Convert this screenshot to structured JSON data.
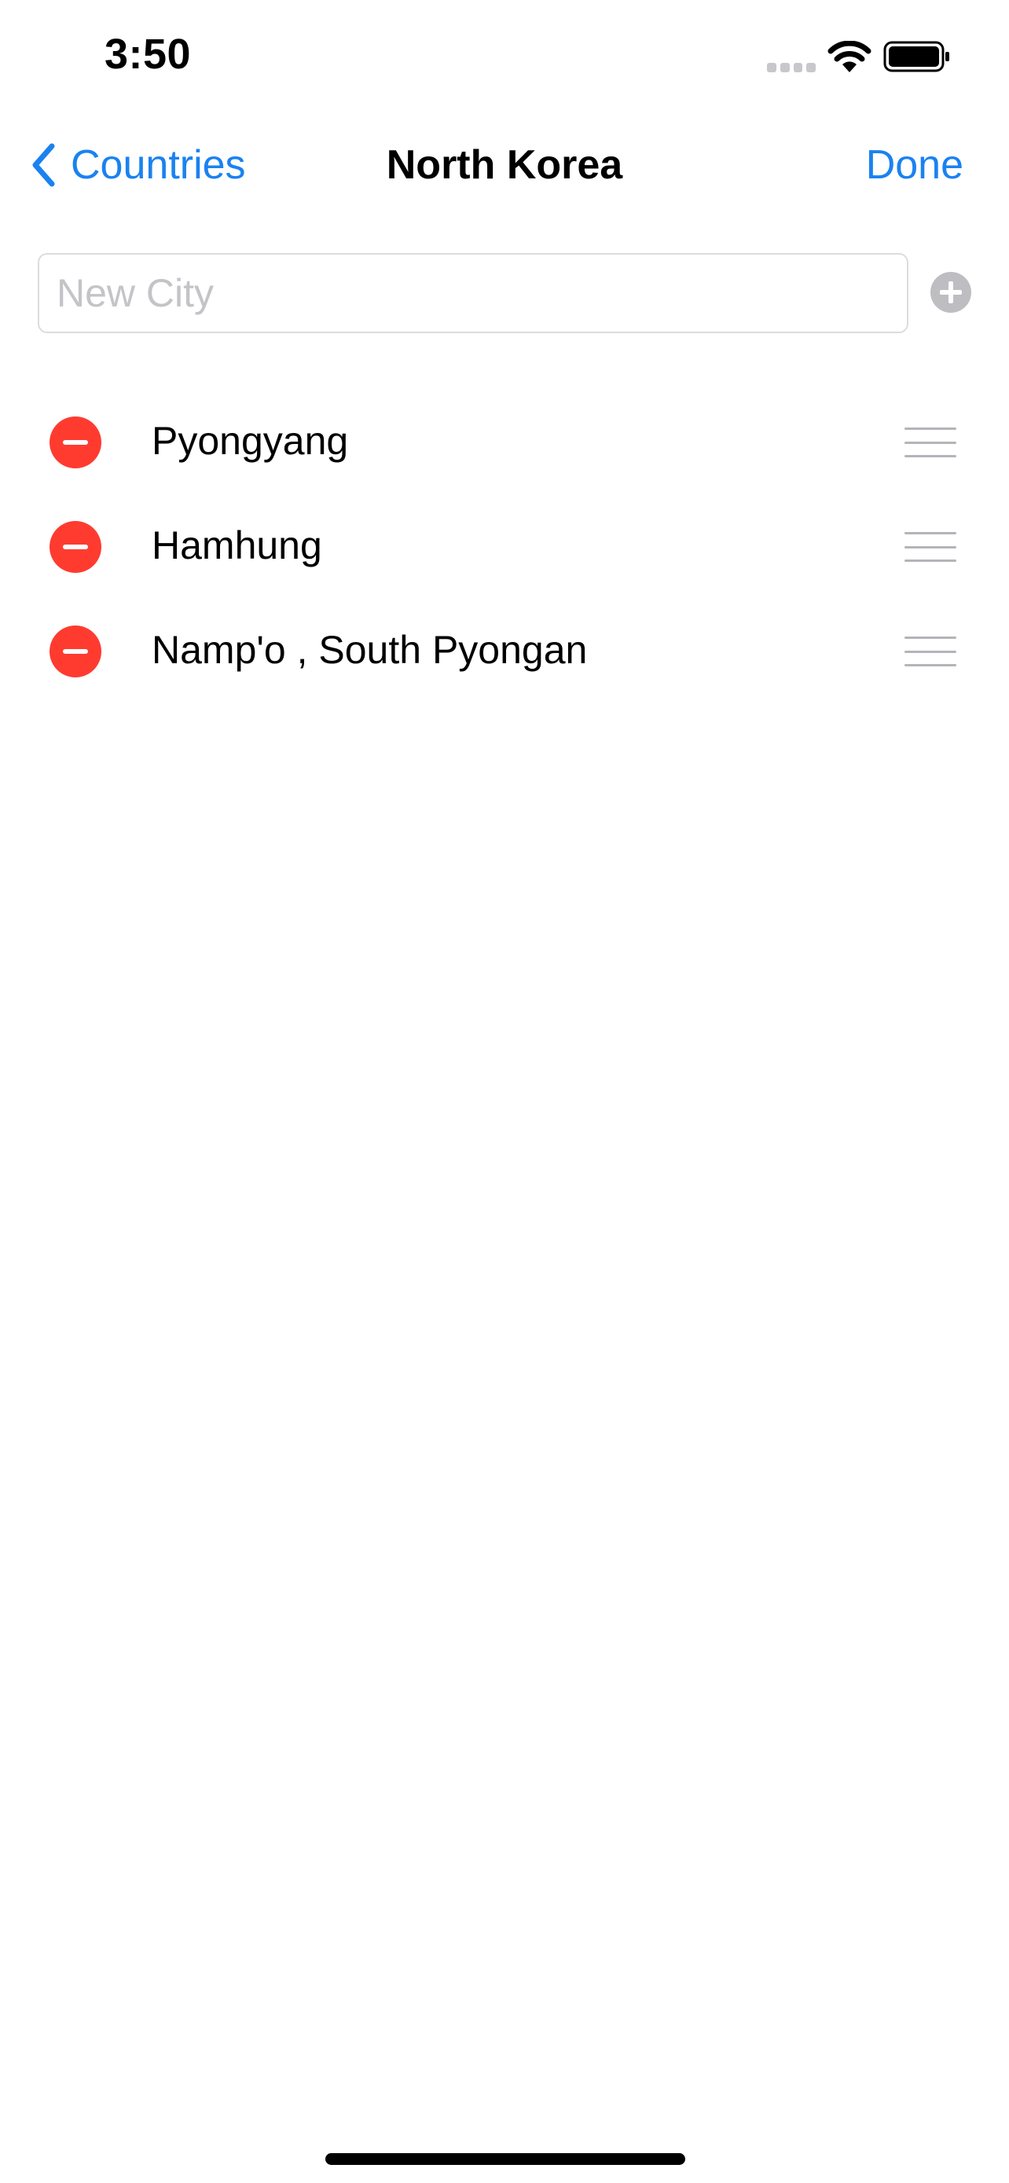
{
  "status_bar": {
    "time": "3:50",
    "icons": [
      "cellular-signal-icon",
      "wifi-icon",
      "battery-icon"
    ]
  },
  "nav": {
    "back_label": "Countries",
    "back_icon": "chevron-left-icon",
    "title": "North Korea",
    "done_label": "Done"
  },
  "new_city": {
    "placeholder": "New City",
    "value": "",
    "add_icon": "plus-circle-icon"
  },
  "cities": [
    {
      "name": "Pyongyang"
    },
    {
      "name": "Hamhung"
    },
    {
      "name": "Namp'o , South Pyongan"
    }
  ],
  "colors": {
    "accent": "#1a82f0",
    "delete": "#ff3b30",
    "handle": "#b4b4ba",
    "placeholder": "#c4c4c8"
  }
}
